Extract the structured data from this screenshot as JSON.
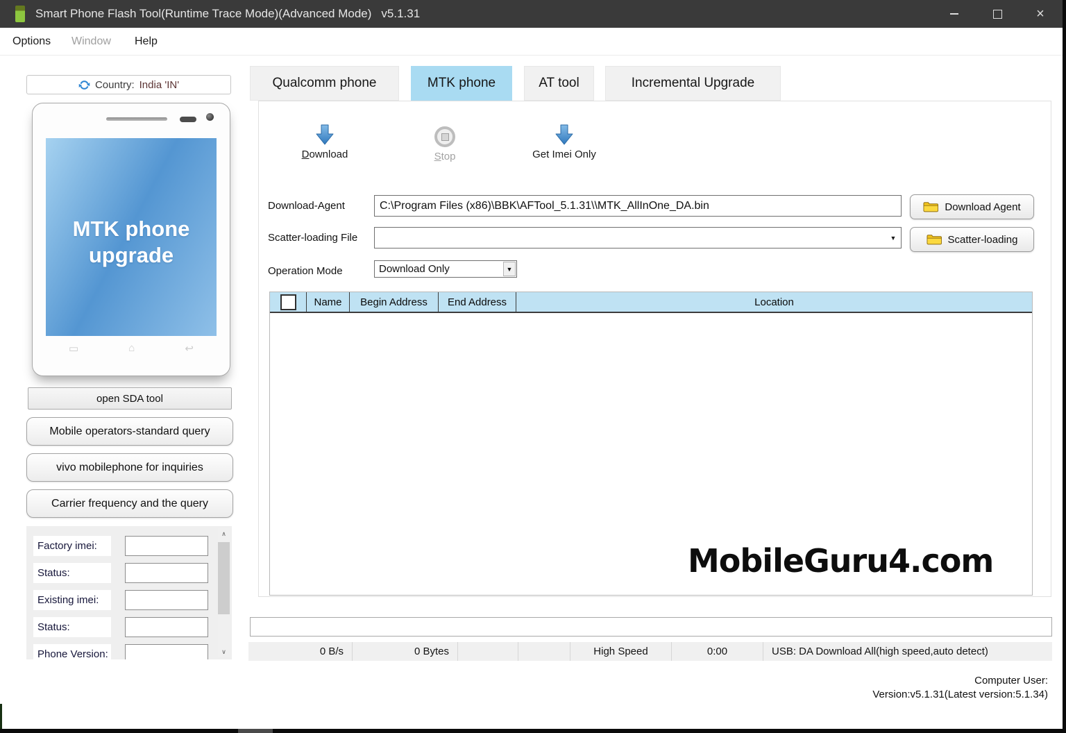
{
  "window": {
    "title": "Smart Phone Flash Tool(Runtime Trace Mode)(Advanced Mode)",
    "version": "v5.1.31"
  },
  "icons": {
    "close": "×",
    "dropdown": "▼",
    "scroll_up": "∧",
    "scroll_down": "∨",
    "nav_menu": "▭",
    "nav_home": "⌂",
    "nav_back": "↩"
  },
  "menu": {
    "items": [
      {
        "label": "Options",
        "enabled": true
      },
      {
        "label": "Window",
        "enabled": false
      },
      {
        "label": "Help",
        "enabled": true
      }
    ]
  },
  "sidebar": {
    "country": {
      "prefix": "Country:",
      "value": "India 'IN'"
    },
    "phone_screen": {
      "line1": "MTK phone",
      "line2": "upgrade"
    },
    "buttons": [
      {
        "label": "open SDA tool"
      },
      {
        "label": "Mobile operators-standard query"
      },
      {
        "label": "vivo mobilephone for inquiries"
      },
      {
        "label": "Carrier frequency and the query"
      }
    ],
    "fields": [
      {
        "label": "Factory imei:",
        "value": ""
      },
      {
        "label": "Status:",
        "value": ""
      },
      {
        "label": "Existing imei:",
        "value": ""
      },
      {
        "label": "Status:",
        "value": ""
      },
      {
        "label": "Phone Version:",
        "value": ""
      }
    ]
  },
  "tabs": [
    {
      "label": "Qualcomm phone",
      "active": false
    },
    {
      "label": "MTK phone",
      "active": true
    },
    {
      "label": "AT tool",
      "active": false
    },
    {
      "label": "Incremental Upgrade",
      "active": false
    }
  ],
  "toolbar": {
    "items": [
      {
        "mnemonic": "D",
        "rest": "ownload",
        "enabled": true
      },
      {
        "mnemonic": "S",
        "rest": "top",
        "enabled": false
      },
      {
        "mnemonic": "",
        "rest": "Get Imei Only",
        "enabled": true
      }
    ]
  },
  "form": {
    "download_agent": {
      "label": "Download-Agent",
      "value": "C:\\Program Files (x86)\\BBK\\AFTool_5.1.31\\\\MTK_AllInOne_DA.bin",
      "button": "Download Agent"
    },
    "scatter_loading": {
      "label": "Scatter-loading File",
      "value": "",
      "button": "Scatter-loading"
    },
    "operation_mode": {
      "label": "Operation Mode",
      "value": "Download Only"
    }
  },
  "table": {
    "columns": [
      "Name",
      "Begin Address",
      "End Address",
      "Location"
    ]
  },
  "watermark": "MobileGuru4.com",
  "statusbar": {
    "speed": "0 B/s",
    "bytes": "0 Bytes",
    "mode": "High Speed",
    "time": "0:00",
    "usb": "USB: DA Download All(high speed,auto detect)"
  },
  "footer": {
    "user_line": "Computer User:",
    "version_line": "Version:v5.1.31(Latest version:5.1.34)"
  },
  "colors": {
    "titlebar": "#3a3a3a",
    "tab_active": "#a9dbf2",
    "table_header": "#bfe2f3",
    "accent_blue": "#3f8fd2",
    "folder_yellow": "#f2c41c"
  }
}
